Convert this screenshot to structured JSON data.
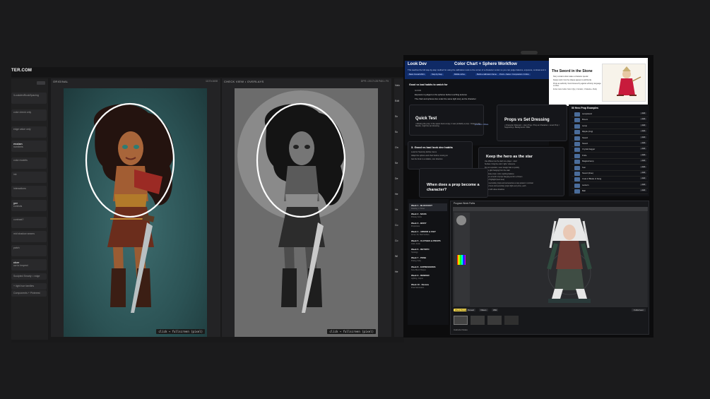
{
  "app": {
    "logo": "TER.COM",
    "sidebar": [
      {
        "title": "",
        "text": "/Lookdev/BookSpacing"
      },
      {
        "title": "",
        "text": "color check only"
      },
      {
        "title": "",
        "text": "edge value only"
      },
      {
        "title": "ession",
        "text": "numbers"
      },
      {
        "title": "",
        "text": "color models"
      },
      {
        "title": "",
        "text": "ink"
      },
      {
        "title": "",
        "text": "interactions"
      },
      {
        "title": "yer",
        "text": "controls"
      },
      {
        "title": "",
        "text": "contrast?"
      },
      {
        "title": "",
        "text": "mid shadow seams"
      },
      {
        "title": "",
        "text": "patch"
      },
      {
        "title": "cker",
        "text": "ow to Inspect"
      },
      {
        "title": "",
        "text": "Sculpted Smarty = edge"
      },
      {
        "title": "",
        "text": "+ light hue families"
      },
      {
        "title": "",
        "text": "Components +  Pinterest"
      }
    ],
    "panel_original": {
      "title": "ORIGINAL",
      "meta": "1107x1608",
      "hint": "click → fullscreen (pixel)"
    },
    "panel_check": {
      "title": "CHECK VIEW • OVERLAYS",
      "meta": "DPR • 2017×28 PAN • Fit",
      "hint": "click → fullscreen (pixel)"
    },
    "clipped_menu": [
      "Valu",
      "Edit",
      "Sc",
      "Sc",
      "On",
      "Se",
      "De",
      "He",
      "He",
      "Co",
      "Co",
      "Wi",
      "He"
    ]
  },
  "collage": {
    "lookdev": {
      "section": "Look Dev",
      "title": "Color Chart + Sphere Workflow",
      "desc": "This teaches the full step-by-step method for using the calibration tools to the corner of a character render so you can judge balance, exposure, contrast and material read with objectivity.",
      "tabs": [
        "Basic Overall 2021",
        "Step by Step",
        "Middle refine",
        "Build a calibration frame",
        "Proof + Salon / Composition / Critics"
      ],
      "section_title": "Good vs bad habits to watch for",
      "good": "GOOD",
      "bullets": [
        "Exposure is judged on the spheres before touching textures",
        "The chart and spheres live under the same light story as the character"
      ]
    },
    "sword": {
      "title": "The Sword in the Stone",
      "items": [
        "Story contains what makes a character special",
        "Design work: how the shapes appear to add bluntly",
        "Props as authority: found lowered by against ethnicity, language or other",
        "Invite more trucks: how 1 Qty, 1 Version, 1 Solenta + Rudy"
      ]
    },
    "slides": {
      "quick_test": "Quick Test",
      "quick_test_sub": "• Missing the prop: if the space feels empty, it was probably a prop  • Swap it: if it bleeds, might be set dressing",
      "props_vs_set": "Props vs Set Dressing",
      "props_vs_set_sub": "• Character Relevant: • Hero Prop / Prop at Character • Level Prop / Supporting • Background / Filler",
      "good_bad": "3. Good vs bad look dev habits",
      "good_bad_items": [
        "Look for Sword-ly kitchen items",
        "Adapt the sphere and chart before moving on",
        "Get the final in a reliable, own direction"
      ],
      "keep_hero": "Keep the hero as the star",
      "keep_hero_items": [
        "Use different as the dash one player - relief",
        "Surface: bring the color / light / reference",
        "Do not reposition, never design hats or quickly",
        "Leave glint hanging from the stain",
        "Duplicate props: color, Lighting balance",
        "Lighten a bunch of props hanging out for a chosen",
        "Is the Highlight (best view)",
        "Keep secondary props and accessories a step quieter in contrast",
        "If your hero and secondary props fight every time, each",
        "Lower with value shadows"
      ],
      "when_prop": "When does a prop become a character?",
      "problem": "problem. More"
    },
    "examples": {
      "title": "50 Hero Prop Examples",
      "rows": [
        "Lampstand",
        "Broom",
        "Lamp",
        "Ripple (ring)",
        "Sword",
        "Sword",
        "Crystal dagger",
        "Knife",
        "Magical lamp",
        "Sun",
        "Sword (blue)",
        "Coat of Blade of Fang",
        "Lantern",
        "Ball"
      ],
      "btn": "Add"
    },
    "weeks": {
      "header": "Program Week Paths",
      "items": [
        {
          "title": "Week 1 · BLOCKOUT",
          "sub": "Reading 1: Primer"
        },
        {
          "title": "Week 2 · MASS",
          "sub": "Primary forms"
        },
        {
          "title": "Week 3 · BODY",
          "sub": "Proportions"
        },
        {
          "title": "Week 4 · ARMOR & FIGT",
          "sub": "Armor, Fit, Hard Surface"
        },
        {
          "title": "Week 5 · CLOTHES & PROPS",
          "sub": "Cloth, Folds"
        },
        {
          "title": "Week 6 · RETOPO",
          "sub": "Topology"
        },
        {
          "title": "Week 7 · POSE",
          "sub": "Posing, Fatty"
        },
        {
          "title": "Week 8 · EXPRESSIONS",
          "sub": "Face Blend Shapes"
        },
        {
          "title": "Week 9 · RENDER",
          "sub": "Lighting, Output"
        },
        {
          "title": "Week 10 · Review",
          "sub": "Final Submission"
        }
      ]
    },
    "program": {
      "title": "Program Week Paths",
      "chips": [
        "Week Prompt",
        "Reveal",
        "Videos",
        "Wiki"
      ],
      "right_btn": "Fullscreen",
      "bottom": "Instructor Notes"
    }
  }
}
